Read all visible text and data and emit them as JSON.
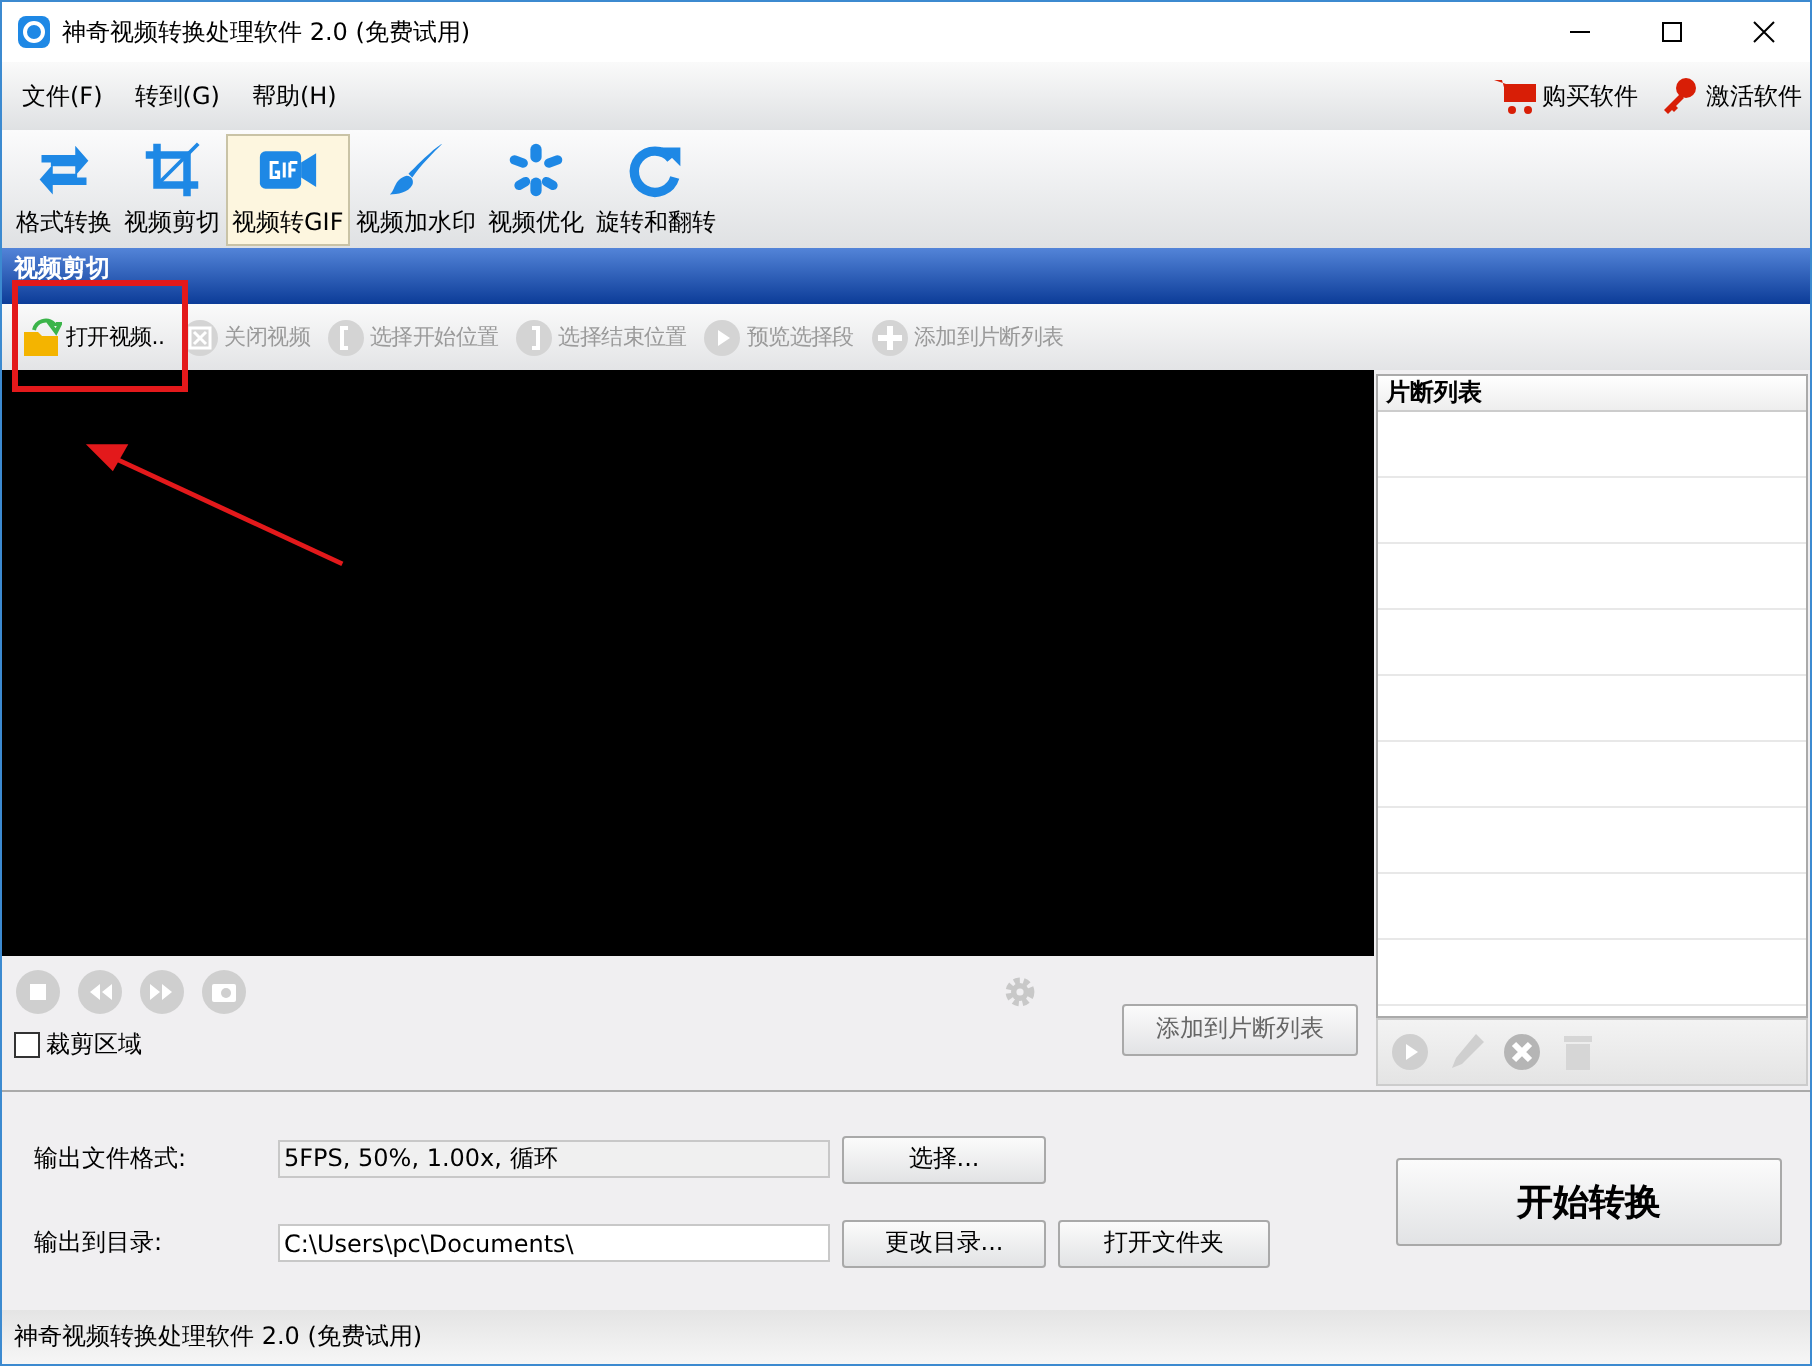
{
  "window": {
    "title": "神奇视频转换处理软件 2.0 (免费试用)"
  },
  "menu": [
    "文件(F)",
    "转到(G)",
    "帮助(H)"
  ],
  "menu_links": [
    "购买软件",
    "激活软件"
  ],
  "toolbar": [
    {
      "label": "格式转换",
      "selected": false
    },
    {
      "label": "视频剪切",
      "selected": false
    },
    {
      "label": "视频转GIF",
      "selected": true
    },
    {
      "label": "视频加水印",
      "selected": false
    },
    {
      "label": "视频优化",
      "selected": false
    },
    {
      "label": "旋转和翻转",
      "selected": false
    }
  ],
  "section_title": "视频剪切",
  "actions": [
    {
      "label": "打开视频..",
      "disabled": false
    },
    {
      "label": "关闭视频",
      "disabled": true
    },
    {
      "label": "选择开始位置",
      "disabled": true
    },
    {
      "label": "选择结束位置",
      "disabled": true
    },
    {
      "label": "预览选择段",
      "disabled": true
    },
    {
      "label": "添加到片断列表",
      "disabled": true
    }
  ],
  "crop_area": {
    "label": "裁剪区域",
    "checked": false
  },
  "add_button": "添加到片断列表",
  "clip_list": {
    "title": "片断列表"
  },
  "output": {
    "format_label": "输出文件格式:",
    "format_value": "5FPS, 50%, 1.00x, 循环",
    "select_button": "选择...",
    "dir_label": "输出到目录:",
    "dir_value": "C:\\Users\\pc\\Documents\\",
    "change_button": "更改目录...",
    "open_button": "打开文件夹"
  },
  "start_button": "开始转换",
  "status_bar": "神奇视频转换处理软件 2.0 (免费试用)"
}
